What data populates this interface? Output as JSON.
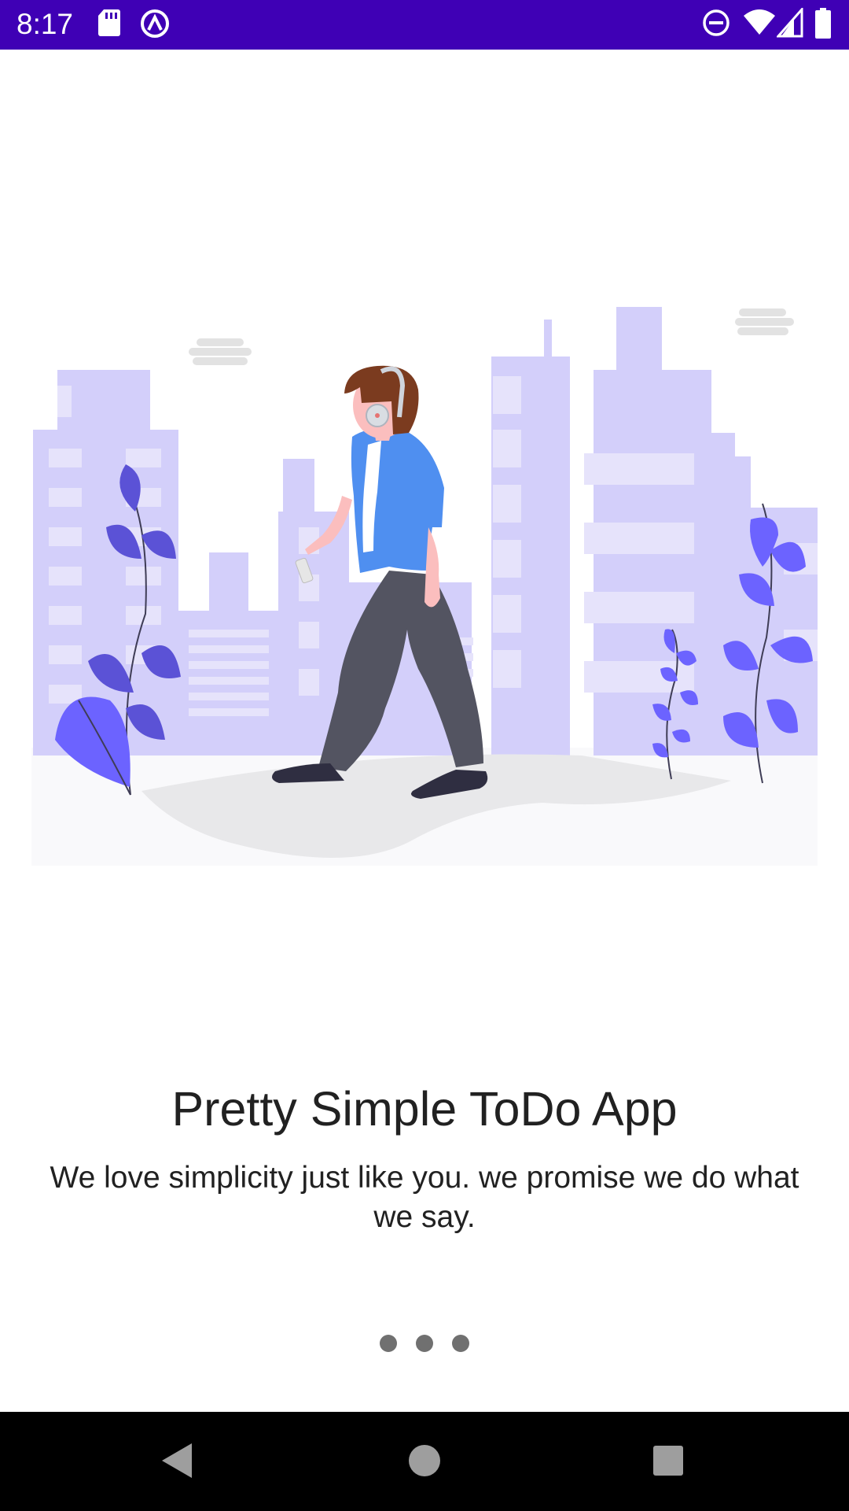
{
  "status_bar": {
    "time": "8:17",
    "background": "#3f00b5",
    "left_icons": [
      "sd-card-icon",
      "data-saver-icon"
    ],
    "right_icons": [
      "do-not-disturb-icon",
      "wifi-icon",
      "signal-icon",
      "battery-icon"
    ]
  },
  "illustration": {
    "description_icon": "walking-person-city-illustration",
    "colors": {
      "buildings": "#d3cffa",
      "windows": "#e6e3fb",
      "leaves": "#6c63ff",
      "leaves_dark": "#5b52d6",
      "shirt": "#4f8ff0",
      "pants": "#535461",
      "ground": "#e8e8ea"
    }
  },
  "onboarding": {
    "title": "Pretty Simple ToDo App",
    "subtitle": "We love simplicity just like you. we promise we do what we say."
  },
  "pager": {
    "page_count": 3,
    "dot_color": "#707070"
  },
  "nav_bar": {
    "buttons": [
      "back-icon",
      "home-icon",
      "recents-icon"
    ]
  }
}
